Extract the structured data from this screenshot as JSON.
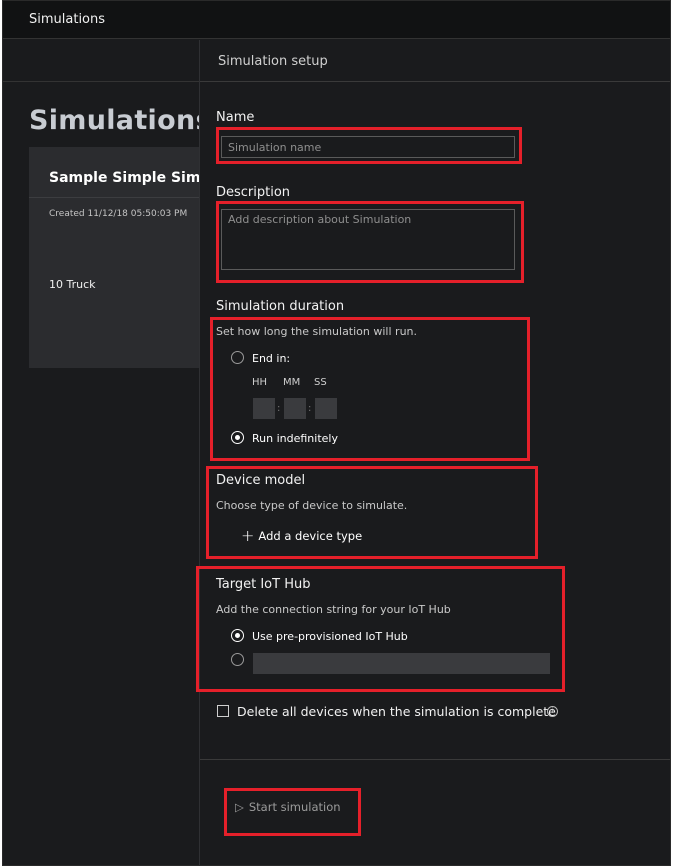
{
  "app": {
    "title": "Simulations"
  },
  "page": {
    "heading": "Simulations"
  },
  "card": {
    "title": "Sample Simple Simulation",
    "created": "Created 11/12/18 05:50:03 PM",
    "devices": "10 Truck"
  },
  "panel": {
    "title": "Simulation setup",
    "name": {
      "label": "Name",
      "placeholder": "Simulation name"
    },
    "description": {
      "label": "Description",
      "placeholder": "Add description about Simulation"
    },
    "duration": {
      "label": "Simulation duration",
      "help": "Set how long the simulation will run.",
      "end_in_label": "End in:",
      "hh": "HH",
      "mm": "MM",
      "ss": "SS",
      "separator": ":",
      "run_indefinitely_label": "Run indefinitely",
      "selected": "run_indefinitely"
    },
    "device_model": {
      "label": "Device model",
      "help": "Choose type of device to simulate.",
      "add_label": "Add a device type"
    },
    "iot_hub": {
      "label": "Target IoT Hub",
      "help": "Add the connection string for your IoT Hub",
      "preprovisioned_label": "Use pre-provisioned IoT Hub",
      "selected": "preprovisioned"
    },
    "delete_devices_label": "Delete all devices when the simulation is complete",
    "info_glyph": "i",
    "start_label": "Start simulation"
  },
  "icons": {
    "plus": "+",
    "play": "▷"
  },
  "colors": {
    "background": "#1a1b1d",
    "card": "#2b2c2f",
    "highlight": "#e5202a"
  }
}
